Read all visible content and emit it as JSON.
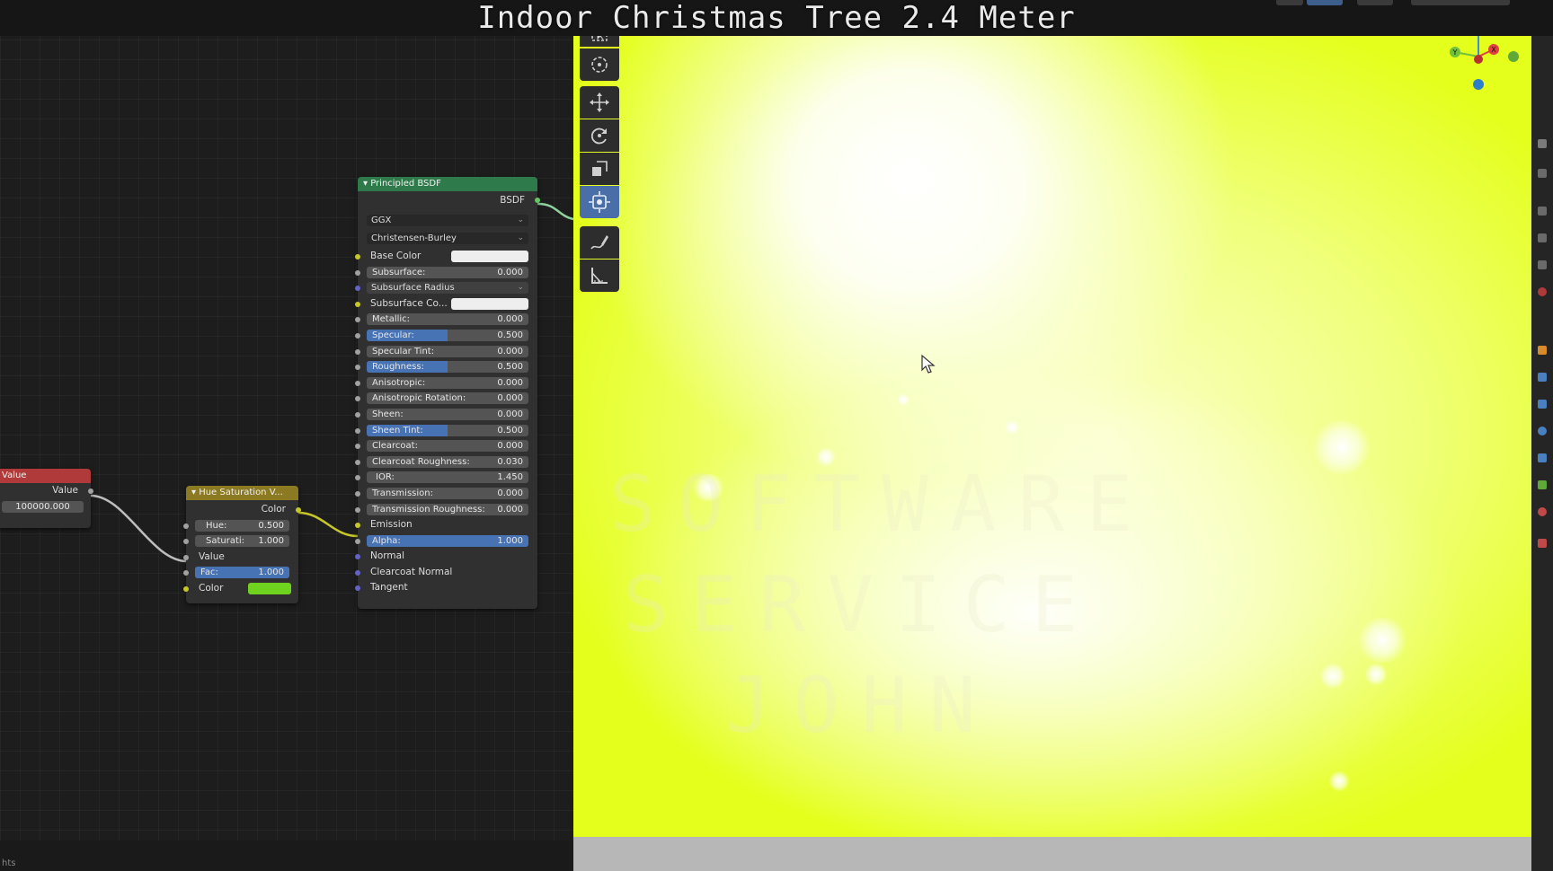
{
  "video_title": "Indoor Christmas Tree 2.4 Meter",
  "watermark": [
    "SOFTWARE",
    "SERVICE",
    "JOHN"
  ],
  "status_text": "hts",
  "value_node": {
    "title": "Value",
    "output_label": "Value",
    "value": "100000.000",
    "header_color": "#b03a3a"
  },
  "hue_sat_node": {
    "title": "Hue Saturation V...",
    "output_label": "Color",
    "hue_label": "Hue:",
    "hue_value": "0.500",
    "saturation_label": "Saturati:",
    "saturation_value": "1.000",
    "value_label": "Value",
    "fac_label": "Fac:",
    "fac_value": "1.000",
    "fac_fraction": 1.0,
    "color_label": "Color",
    "color_swatch": "#6fd21f",
    "header_color": "#8c7a22"
  },
  "bsdf_node": {
    "title": "Principled BSDF",
    "output_label": "BSDF",
    "header_color": "#2f7a4b",
    "distribution": "GGX",
    "subsurface_method": "Christensen-Burley",
    "base_color_label": "Base Color",
    "base_color_swatch": "#eeeeee",
    "subsurface_label": "Subsurface:",
    "subsurface_value": "0.000",
    "subsurface_radius_label": "Subsurface Radius",
    "subsurface_color_label": "Subsurface Co...",
    "subsurface_color_swatch": "#eeeeee",
    "metallic_label": "Metallic:",
    "metallic_value": "0.000",
    "specular_label": "Specular:",
    "specular_value": "0.500",
    "specular_fraction": 0.5,
    "specular_tint_label": "Specular Tint:",
    "specular_tint_value": "0.000",
    "roughness_label": "Roughness:",
    "roughness_value": "0.500",
    "roughness_fraction": 0.5,
    "anisotropic_label": "Anisotropic:",
    "anisotropic_value": "0.000",
    "anisotropic_rotation_label": "Anisotropic Rotation:",
    "anisotropic_rotation_value": "0.000",
    "sheen_label": "Sheen:",
    "sheen_value": "0.000",
    "sheen_tint_label": "Sheen Tint:",
    "sheen_tint_value": "0.500",
    "sheen_tint_fraction": 0.5,
    "clearcoat_label": "Clearcoat:",
    "clearcoat_value": "0.000",
    "clearcoat_roughness_label": "Clearcoat Roughness:",
    "clearcoat_roughness_value": "0.030",
    "ior_label": "IOR:",
    "ior_value": "1.450",
    "transmission_label": "Transmission:",
    "transmission_value": "0.000",
    "transmission_roughness_label": "Transmission Roughness:",
    "transmission_roughness_value": "0.000",
    "emission_label": "Emission",
    "alpha_label": "Alpha:",
    "alpha_value": "1.000",
    "alpha_fraction": 1.0,
    "normal_label": "Normal",
    "clearcoat_normal_label": "Clearcoat Normal",
    "tangent_label": "Tangent"
  },
  "toolbar_icons": [
    "select-box-icon",
    "cursor-icon",
    "move-icon",
    "rotate-icon",
    "scale-icon",
    "transform-icon",
    "annotate-icon",
    "measure-icon"
  ],
  "gizmo_labels": {
    "x": "X",
    "y": "Y",
    "z": "Z"
  },
  "colors": {
    "viewport_yellow": "#e8ff2a",
    "active_tool": "#4a6fa8",
    "slider_fill": "#4772b3"
  }
}
